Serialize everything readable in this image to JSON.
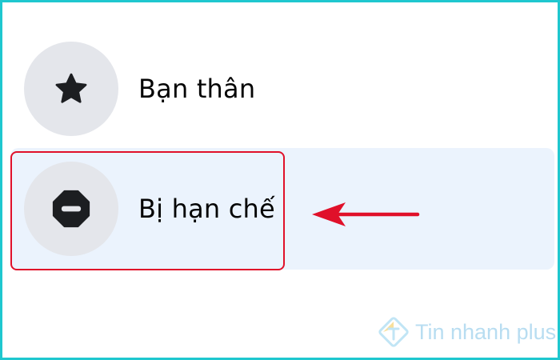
{
  "friend_lists": {
    "items": [
      {
        "label": "Bạn thân",
        "icon": "star-icon"
      },
      {
        "label": "Bị hạn chế",
        "icon": "restricted-icon",
        "selected": true
      }
    ]
  },
  "annotation": {
    "highlight_color": "#e0102a",
    "arrow_icon": "arrow-left-icon"
  },
  "watermark": {
    "text": "Tin nhanh plus"
  },
  "colors": {
    "border": "#1fc7cf",
    "selected_row_bg": "#ebf3fd",
    "icon_circle_bg": "#e4e6eb",
    "icon_fill": "#1c1e21",
    "text": "#050505"
  }
}
